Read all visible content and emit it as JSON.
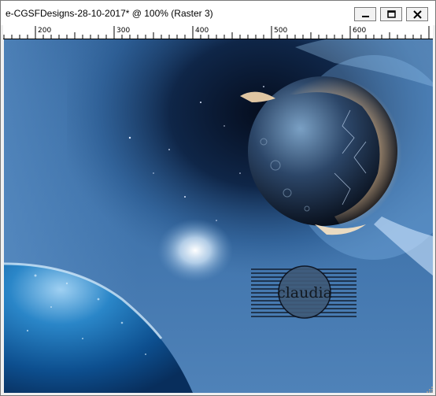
{
  "window": {
    "title": "e-CGSFDesigns-28-10-2017* @ 100% (Raster 3)",
    "buttons": {
      "minimize_icon": "minimize-icon",
      "maximize_icon": "maximize-icon",
      "close_icon": "close-icon"
    }
  },
  "ruler": {
    "labels": [
      "200",
      "300",
      "400",
      "500",
      "600"
    ]
  },
  "canvas": {
    "watermark_text": "claudia",
    "colors": {
      "sky": "#3a6a9e",
      "deep_space": "#0b1a33",
      "planet_glow": "#f5d6a8",
      "water": "#1e6fb0"
    }
  }
}
